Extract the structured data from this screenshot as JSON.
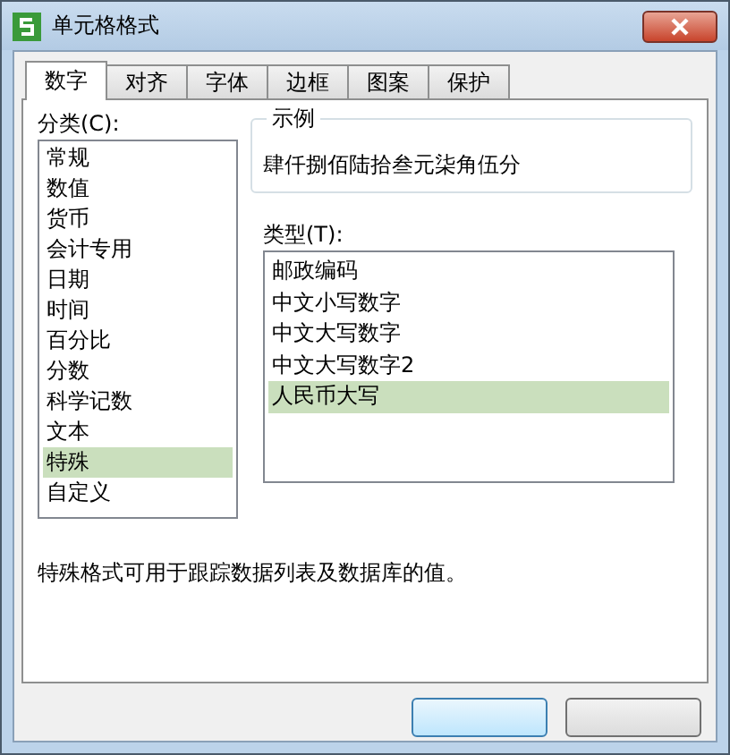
{
  "window": {
    "title": "单元格格式"
  },
  "tabs": [
    {
      "label": "数字",
      "selected": true
    },
    {
      "label": "对齐",
      "selected": false
    },
    {
      "label": "字体",
      "selected": false
    },
    {
      "label": "边框",
      "selected": false
    },
    {
      "label": "图案",
      "selected": false
    },
    {
      "label": "保护",
      "selected": false
    }
  ],
  "category": {
    "label": "分类(C):",
    "items": [
      {
        "label": "常规",
        "selected": false
      },
      {
        "label": "数值",
        "selected": false
      },
      {
        "label": "货币",
        "selected": false
      },
      {
        "label": "会计专用",
        "selected": false
      },
      {
        "label": "日期",
        "selected": false
      },
      {
        "label": "时间",
        "selected": false
      },
      {
        "label": "百分比",
        "selected": false
      },
      {
        "label": "分数",
        "selected": false
      },
      {
        "label": "科学记数",
        "selected": false
      },
      {
        "label": "文本",
        "selected": false
      },
      {
        "label": "特殊",
        "selected": true
      },
      {
        "label": "自定义",
        "selected": false
      }
    ]
  },
  "sample": {
    "title": "示例",
    "value": "肆仟捌佰陆拾叁元柒角伍分"
  },
  "type": {
    "label": "类型(T):",
    "items": [
      {
        "label": "邮政编码",
        "selected": false
      },
      {
        "label": "中文小写数字",
        "selected": false
      },
      {
        "label": "中文大写数字",
        "selected": false
      },
      {
        "label": "中文大写数字2",
        "selected": false
      },
      {
        "label": "人民币大写",
        "selected": true
      }
    ]
  },
  "description": "特殊格式可用于跟踪数据列表及数据库的值。",
  "buttons": [
    {
      "kind": "default"
    },
    {
      "kind": "normal"
    }
  ]
}
